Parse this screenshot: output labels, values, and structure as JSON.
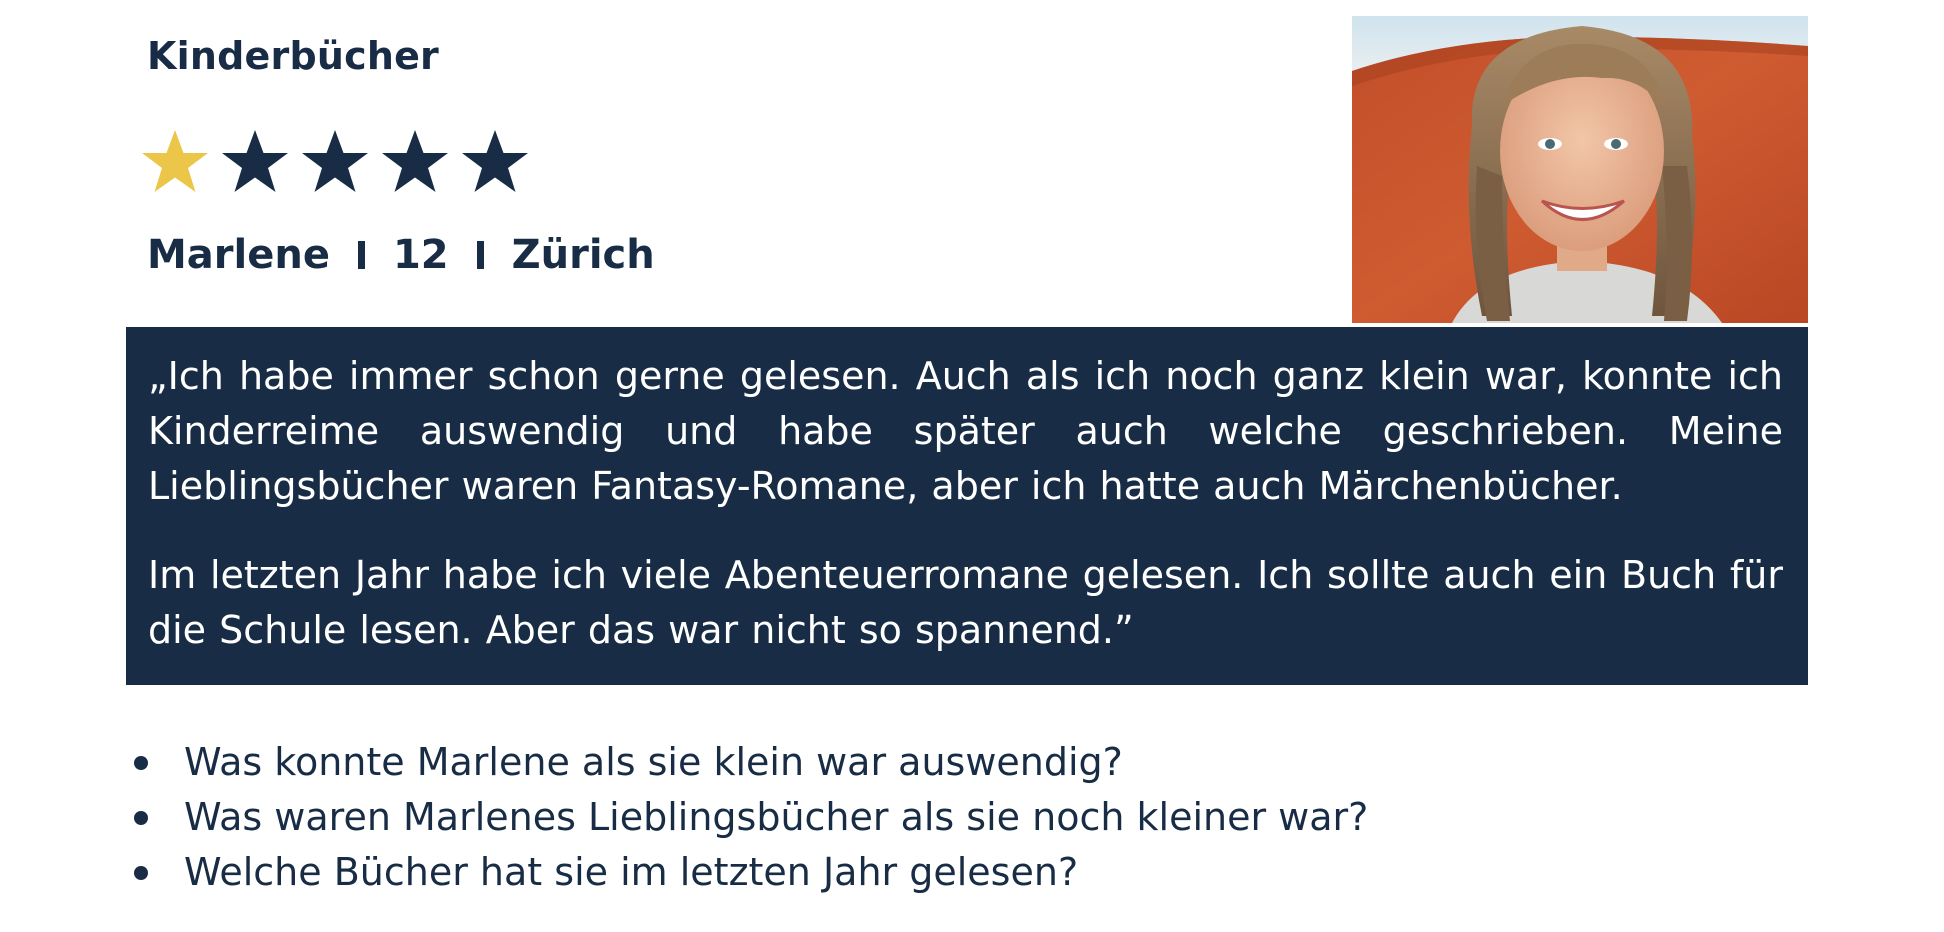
{
  "header": {
    "category": "Kinderbücher",
    "rating": {
      "value": 1,
      "max": 5
    },
    "profile": {
      "name": "Marlene",
      "age": "12",
      "city": "Zürich"
    }
  },
  "photo": {
    "icon": "portrait-photo"
  },
  "quote": {
    "paragraphs": [
      "„Ich habe immer schon gerne gelesen. Auch als ich noch ganz klein war, konnte ich Kinderreime auswendig und habe später auch welche geschrieben. Meine Lieblingsbücher waren Fantasy-Romane, aber ich hatte auch Märchenbücher.",
      "Im letzten Jahr habe ich viele Abenteuerromane gelesen. Ich sollte auch ein Buch für die Schule lesen. Aber das war nicht so spannend.”"
    ]
  },
  "questions": [
    "Was konnte Marlene als sie klein war auswendig?",
    "Was waren Marlenes Lieblingsbücher als sie noch kleiner war?",
    "Welche Bücher hat sie im letzten Jahr gelesen?"
  ],
  "colors": {
    "navy": "#182d45",
    "star_filled": "#ecc648",
    "star_empty": "#182d45",
    "background": "#ffffff"
  }
}
